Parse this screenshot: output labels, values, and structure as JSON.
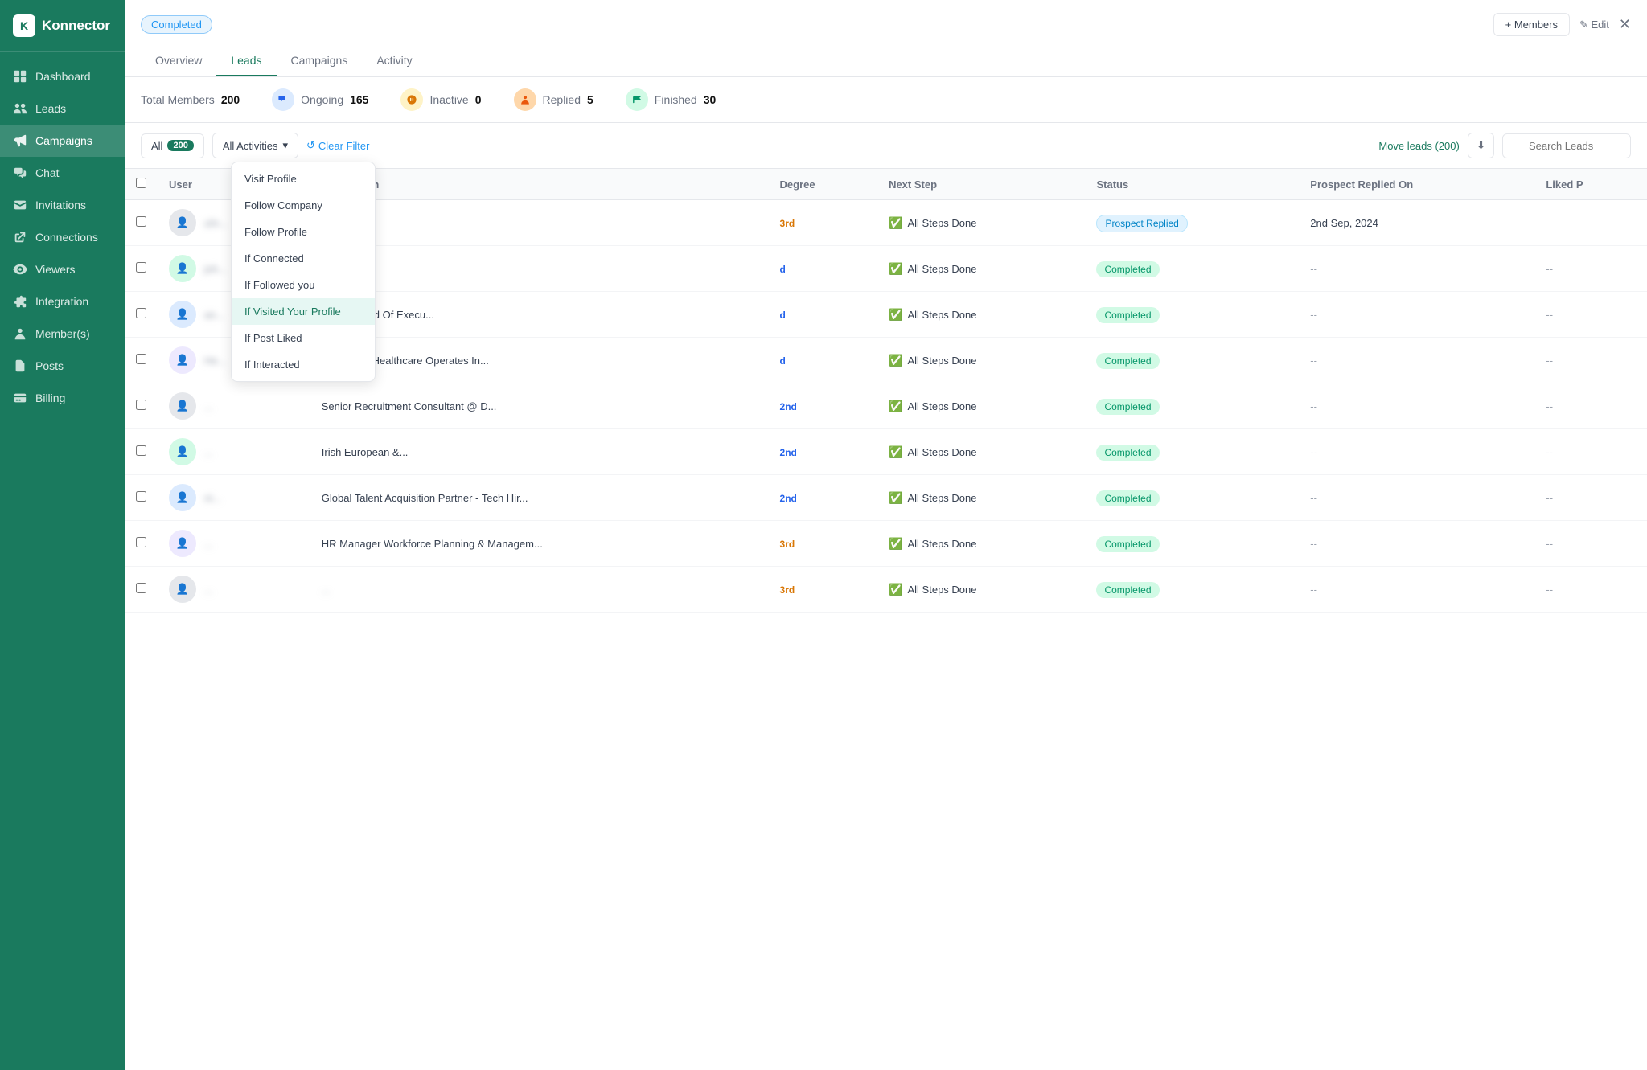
{
  "app": {
    "name": "Konnector",
    "logo_letter": "K"
  },
  "sidebar": {
    "items": [
      {
        "id": "dashboard",
        "label": "Dashboard",
        "icon": "grid"
      },
      {
        "id": "leads",
        "label": "Leads",
        "icon": "users",
        "active": false
      },
      {
        "id": "campaigns",
        "label": "Campaigns",
        "icon": "megaphone",
        "active": true
      },
      {
        "id": "chat",
        "label": "Chat",
        "icon": "chat"
      },
      {
        "id": "invitations",
        "label": "Invitations",
        "icon": "mail"
      },
      {
        "id": "connections",
        "label": "Connections",
        "icon": "link"
      },
      {
        "id": "viewers",
        "label": "Viewers",
        "icon": "eye"
      },
      {
        "id": "integration",
        "label": "Integration",
        "icon": "puzzle"
      },
      {
        "id": "members",
        "label": "Member(s)",
        "icon": "person"
      },
      {
        "id": "posts",
        "label": "Posts",
        "icon": "file"
      },
      {
        "id": "billing",
        "label": "Billing",
        "icon": "card"
      }
    ]
  },
  "campaign": {
    "badge": "Completed",
    "tabs": [
      {
        "id": "overview",
        "label": "Overview"
      },
      {
        "id": "leads",
        "label": "Leads",
        "active": true
      },
      {
        "id": "campaigns",
        "label": "Campaigns"
      },
      {
        "id": "activity",
        "label": "Activity"
      }
    ],
    "actions": {
      "members_btn": "+ Members",
      "edit_btn": "✎ Edit",
      "close_btn": "✕"
    }
  },
  "stats": {
    "total_members_label": "Total Members",
    "total_members_value": "200",
    "ongoing_label": "Ongoing",
    "ongoing_value": "165",
    "inactive_label": "Inactive",
    "inactive_value": "0",
    "replied_label": "Replied",
    "replied_value": "5",
    "finished_label": "Finished",
    "finished_value": "30"
  },
  "filter": {
    "all_label": "All",
    "count": "200",
    "activities_label": "All Activities",
    "clear_label": "Clear Filter",
    "move_leads": "Move leads (200)",
    "search_placeholder": "Search Leads"
  },
  "dropdown": {
    "items": [
      {
        "id": "visit-profile",
        "label": "Visit Profile"
      },
      {
        "id": "follow-company",
        "label": "Follow Company"
      },
      {
        "id": "follow-profile",
        "label": "Follow Profile"
      },
      {
        "id": "if-connected",
        "label": "If Connected"
      },
      {
        "id": "if-followed-you",
        "label": "If Followed you"
      },
      {
        "id": "if-visited-profile",
        "label": "If Visited Your Profile",
        "highlighted": true
      },
      {
        "id": "if-post-liked",
        "label": "If Post Liked"
      },
      {
        "id": "if-interacted",
        "label": "If Interacted"
      }
    ]
  },
  "table": {
    "columns": [
      "User",
      "Occupation",
      "Degree",
      "Next Step",
      "Status",
      "Prospect Replied On",
      "Liked P"
    ],
    "rows": [
      {
        "user": "uhr...",
        "user_blurred": true,
        "occupation": "...",
        "occupation_blurred": true,
        "degree": "3rd",
        "degree_color": "orange",
        "next_step": "All Steps Done",
        "status": "Prospect Replied",
        "status_type": "replied",
        "replied_on": "2nd Sep, 2024",
        "liked": ""
      },
      {
        "user": "joh...",
        "user_blurred": true,
        "occupation": "...",
        "occupation_blurred": true,
        "degree": "d",
        "degree_color": "blue",
        "next_step": "All Steps Done",
        "status": "Completed",
        "status_type": "completed",
        "replied_on": "--",
        "liked": "--"
      },
      {
        "user": "an...",
        "user_blurred": true,
        "occupation": "Global Head Of Execu...",
        "occupation_blurred": false,
        "degree": "d",
        "degree_color": "blue",
        "next_step": "All Steps Done",
        "status": "Completed",
        "status_type": "completed",
        "replied_on": "--",
        "liked": "--"
      },
      {
        "user": "He...",
        "user_blurred": true,
        "occupation": "Peamount Healthcare Operates In...",
        "occupation_blurred": false,
        "degree": "d",
        "degree_color": "blue",
        "next_step": "All Steps Done",
        "status": "Completed",
        "status_type": "completed",
        "replied_on": "--",
        "liked": "--"
      },
      {
        "user": "...",
        "user_blurred": true,
        "occupation": "Senior Recruitment Consultant @ D...",
        "occupation_blurred": false,
        "degree": "2nd",
        "degree_color": "blue",
        "next_step": "All Steps Done",
        "status": "Completed",
        "status_type": "completed",
        "replied_on": "--",
        "liked": "--"
      },
      {
        "user": "...",
        "user_blurred": true,
        "occupation": "Irish European &...",
        "occupation_blurred": false,
        "degree": "2nd",
        "degree_color": "blue",
        "next_step": "All Steps Done",
        "status": "Completed",
        "status_type": "completed",
        "replied_on": "--",
        "liked": "--"
      },
      {
        "user": "ni...",
        "user_blurred": true,
        "occupation": "Global Talent Acquisition Partner - Tech Hir...",
        "occupation_blurred": false,
        "degree": "2nd",
        "degree_color": "blue",
        "next_step": "All Steps Done",
        "status": "Completed",
        "status_type": "completed",
        "replied_on": "--",
        "liked": "--"
      },
      {
        "user": "...",
        "user_blurred": true,
        "occupation": "HR Manager Workforce Planning & Managem...",
        "occupation_blurred": false,
        "degree": "3rd",
        "degree_color": "orange",
        "next_step": "All Steps Done",
        "status": "Completed",
        "status_type": "completed",
        "replied_on": "--",
        "liked": "--"
      },
      {
        "user": "...",
        "user_blurred": true,
        "occupation": "...",
        "occupation_blurred": true,
        "degree": "3rd",
        "degree_color": "orange",
        "next_step": "All Steps Done",
        "status": "Completed",
        "status_type": "completed",
        "replied_on": "--",
        "liked": "--"
      }
    ]
  }
}
